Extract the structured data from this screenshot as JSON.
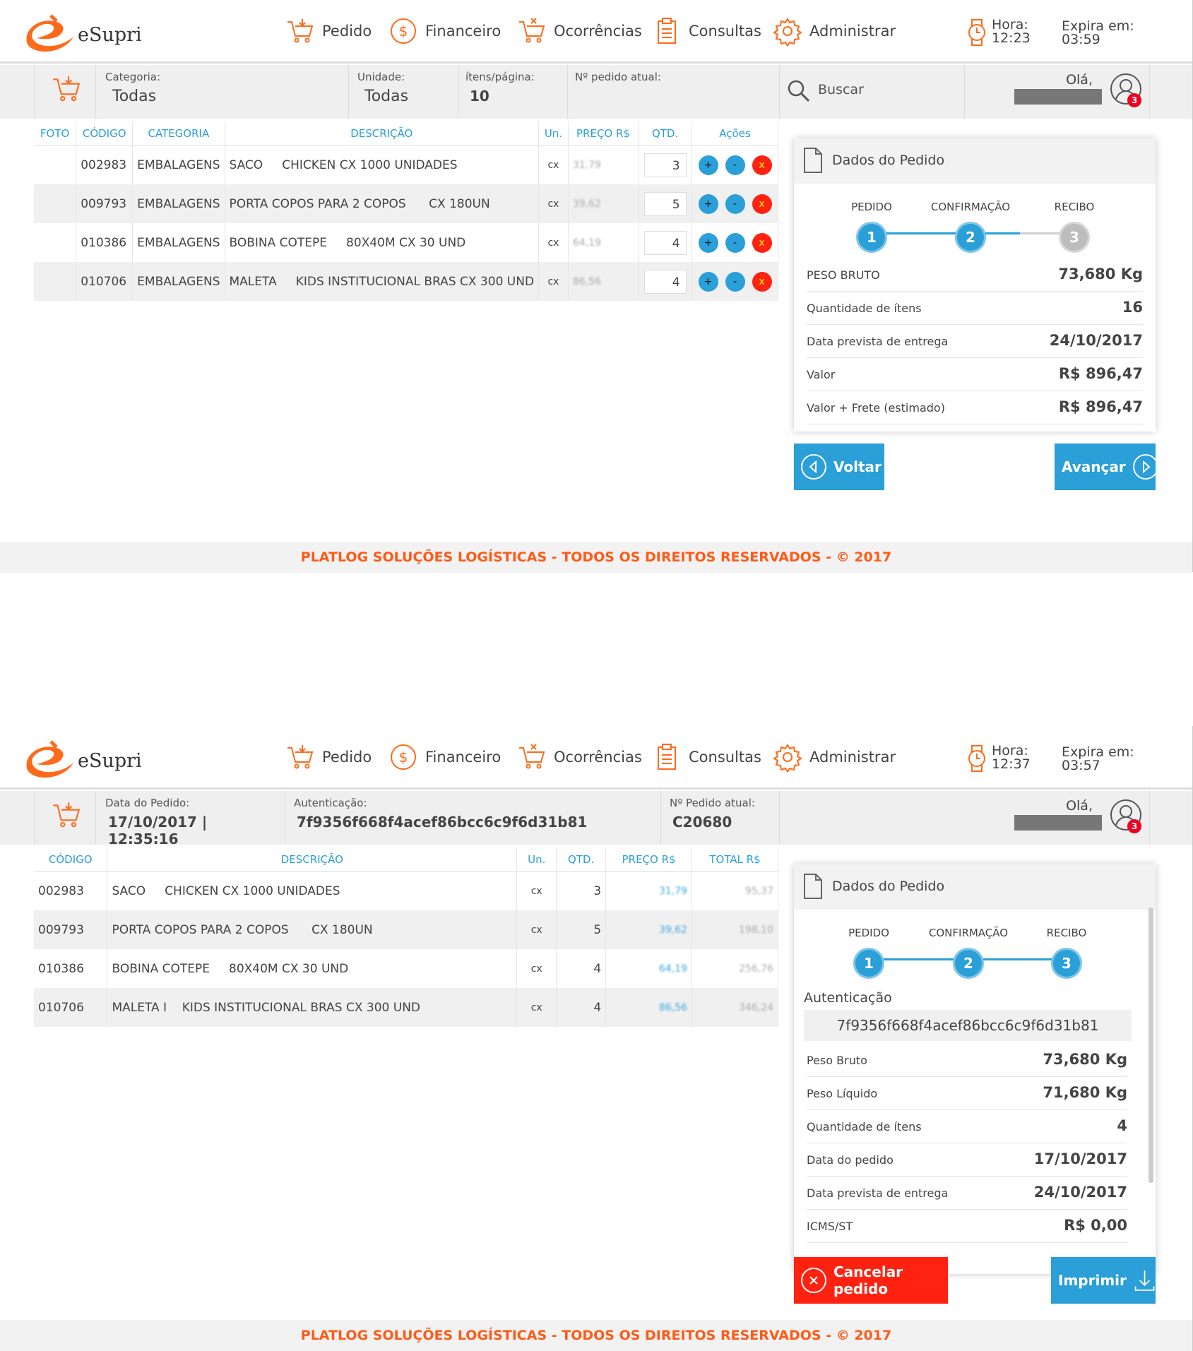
{
  "brand": {
    "name": "eSupri"
  },
  "nav": {
    "pedido": "Pedido",
    "financeiro": "Financeiro",
    "ocorrencias": "Ocorrências",
    "consultas": "Consultas",
    "administrar": "Administrar"
  },
  "colors": {
    "accent": "#2a9fd8",
    "brand": "#ff6a1a",
    "danger": "#ff2211",
    "footer_text": "#ff5a17"
  },
  "screen1": {
    "clock_label": "Hora:",
    "clock_time": "12:23",
    "expira_label": "Expira em:",
    "expira_value": "03:59",
    "filters": {
      "categoria_label": "Categoria:",
      "categoria_value": "Todas",
      "unidade_label": "Unidade:",
      "unidade_value": "Todas",
      "itens_label": "ítens/página:",
      "itens_value": "10",
      "pedido_label": "Nº pedido atual:",
      "pedido_value": ""
    },
    "search_placeholder": "Buscar",
    "greeting": "Olá,",
    "notification_count": "3",
    "table": {
      "headers": [
        "FOTO",
        "CÓDIGO",
        "CATEGORIA",
        "DESCRIÇÃO",
        "Un.",
        "PREÇO R$",
        "QTD.",
        "Ações"
      ],
      "rows": [
        {
          "codigo": "002983",
          "categoria": "EMBALAGENS",
          "descricao": "SACO     CHICKEN CX 1000 UNIDADES",
          "un": "cx",
          "preco": "31,79",
          "qtd": "3"
        },
        {
          "codigo": "009793",
          "categoria": "EMBALAGENS",
          "descricao": "PORTA COPOS PARA 2 COPOS      CX 180UN",
          "un": "cx",
          "preco": "39,62",
          "qtd": "5"
        },
        {
          "codigo": "010386",
          "categoria": "EMBALAGENS",
          "descricao": "BOBINA COTEPE     80X40M CX 30 UND",
          "un": "cx",
          "preco": "64,19",
          "qtd": "4"
        },
        {
          "codigo": "010706",
          "categoria": "EMBALAGENS",
          "descricao": "MALETA     KIDS INSTITUCIONAL BRAS CX 300 UND",
          "un": "cx",
          "preco": "86,56",
          "qtd": "4"
        }
      ],
      "action_plus": "+",
      "action_minus": "-",
      "action_remove": "x"
    },
    "panel": {
      "title": "Dados do Pedido",
      "steps": [
        {
          "label": "PEDIDO",
          "num": "1",
          "done": true
        },
        {
          "label": "CONFIRMAÇÃO",
          "num": "2",
          "done": true
        },
        {
          "label": "RECIBO",
          "num": "3",
          "done": false
        }
      ],
      "rows": [
        {
          "label": "PESO BRUTO",
          "value": "73,680 Kg"
        },
        {
          "label": "Quantidade de ítens",
          "value": "16"
        },
        {
          "label": "Data prevista de entrega",
          "value": "24/10/2017"
        },
        {
          "label": "Valor",
          "value": "R$ 896,47"
        },
        {
          "label": "Valor + Frete (estimado)",
          "value": "R$ 896,47"
        }
      ]
    },
    "btn_voltar": "Voltar",
    "btn_avancar": "Avançar"
  },
  "screen2": {
    "clock_label": "Hora:",
    "clock_time": "12:37",
    "expira_label": "Expira em:",
    "expira_value": "03:57",
    "filters": {
      "data_label": "Data do Pedido:",
      "data_value": "17/10/2017 | 12:35:16",
      "auth_label": "Autenticação:",
      "auth_value": "7f9356f668f4acef86bcc6c9f6d31b81",
      "pedido_label": "Nº Pedido atual:",
      "pedido_value": "C20680"
    },
    "greeting": "Olá,",
    "notification_count": "3",
    "table": {
      "headers": [
        "CÓDIGO",
        "DESCRIÇÃO",
        "Un.",
        "QTD.",
        "PREÇO R$",
        "TOTAL R$"
      ],
      "rows": [
        {
          "codigo": "002983",
          "descricao": "SACO     CHICKEN CX 1000 UNIDADES",
          "un": "cx",
          "qtd": "3",
          "preco": "31,79",
          "total": "95,37"
        },
        {
          "codigo": "009793",
          "descricao": "PORTA COPOS PARA 2 COPOS      CX 180UN",
          "un": "cx",
          "qtd": "5",
          "preco": "39,62",
          "total": "198,10"
        },
        {
          "codigo": "010386",
          "descricao": "BOBINA COTEPE     80X40M CX 30 UND",
          "un": "cx",
          "qtd": "4",
          "preco": "64,19",
          "total": "256,76"
        },
        {
          "codigo": "010706",
          "descricao": "MALETA I    KIDS INSTITUCIONAL BRAS CX 300 UND",
          "un": "cx",
          "qtd": "4",
          "preco": "86,56",
          "total": "346,24"
        }
      ]
    },
    "panel": {
      "title": "Dados do Pedido",
      "steps": [
        {
          "label": "PEDIDO",
          "num": "1",
          "done": true
        },
        {
          "label": "CONFIRMAÇÃO",
          "num": "2",
          "done": true
        },
        {
          "label": "RECIBO",
          "num": "3",
          "done": true
        }
      ],
      "auth_label": "Autenticação",
      "auth_value": "7f9356f668f4acef86bcc6c9f6d31b81",
      "rows": [
        {
          "label": "Peso Bruto",
          "value": "73,680 Kg"
        },
        {
          "label": "Peso Líquido",
          "value": "71,680 Kg"
        },
        {
          "label": "Quantidade de ítens",
          "value": "4"
        },
        {
          "label": "Data do pedido",
          "value": "17/10/2017"
        },
        {
          "label": "Data prevista de entrega",
          "value": "24/10/2017"
        },
        {
          "label": "ICMS/ST",
          "value": "R$ 0,00"
        }
      ]
    },
    "btn_cancelar": "Cancelar pedido",
    "btn_imprimir": "Imprimir"
  },
  "footer": "PLATLOG SOLUÇÕES LOGÍSTICAS - TODOS OS DIREITOS RESERVADOS - © 2017"
}
